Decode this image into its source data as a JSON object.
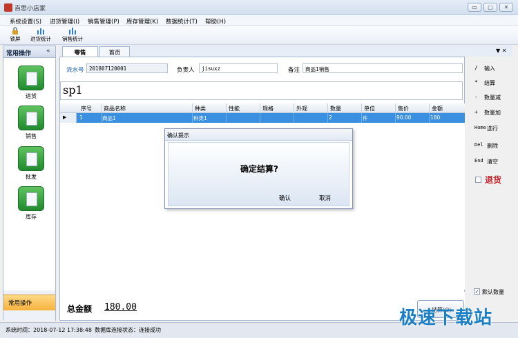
{
  "window": {
    "title": "百思小店家",
    "controls": [
      "▭",
      "▢",
      "✕"
    ]
  },
  "menubar": {
    "items": [
      "系统设置(S)",
      "进货管理(I)",
      "销售管理(P)",
      "库存管理(K)",
      "数据统计(T)",
      "帮助(H)"
    ]
  },
  "toolbar": {
    "items": [
      "锁屏",
      "进货统计",
      "销售统计"
    ]
  },
  "sidebar": {
    "title": "常用操作",
    "collapse_glyph": "«",
    "items": [
      {
        "label": "进货",
        "icon": "notepad-icon"
      },
      {
        "label": "销售",
        "icon": "dollar-doc-icon"
      },
      {
        "label": "批发",
        "icon": "window-doc-icon"
      },
      {
        "label": "库存",
        "icon": "magnifier-doc-icon"
      }
    ],
    "active_section": "常用操作"
  },
  "tabs": {
    "items": [
      "零售",
      "首页"
    ],
    "active": "零售",
    "right_glyphs": "▼ ✕"
  },
  "form": {
    "serial_label": "流水号",
    "serial_value": "201807120001",
    "person_label": "负责人",
    "person_value": "jisuxz",
    "note_label": "备注",
    "note_value": "商品1销售",
    "code_input": "sp1"
  },
  "grid": {
    "columns": [
      "序号",
      "商品名称",
      "种类",
      "性能",
      "规格",
      "外观",
      "数量",
      "单位",
      "售价",
      "金额"
    ],
    "rows": [
      {
        "cells": [
          "1",
          "商品1",
          "种类1",
          "",
          "",
          "",
          "2",
          "件",
          "90.00",
          "180"
        ]
      }
    ]
  },
  "dialog": {
    "title": "确认提示",
    "message": "确定结算?",
    "confirm_label": "确认",
    "cancel_label": "取消"
  },
  "total": {
    "label": "总金额",
    "value": "180.00"
  },
  "shortcuts": [
    {
      "key": "/",
      "label": "输入"
    },
    {
      "key": "*",
      "label": "结算"
    },
    {
      "key": "-",
      "label": "数量减"
    },
    {
      "key": "+",
      "label": "数量加"
    },
    {
      "key": "Home",
      "label": "选行"
    },
    {
      "key": "Del",
      "label": "删除"
    },
    {
      "key": "End",
      "label": "清空"
    }
  ],
  "return_label": "退货",
  "default_qty_label": "默认数量",
  "settle_button_label": "结算(O)",
  "status": {
    "time_label": "系统时间：2018-07-12 17:38:48",
    "db_label": "数据库连接状态：连接成功"
  },
  "watermark": "极速下载站"
}
